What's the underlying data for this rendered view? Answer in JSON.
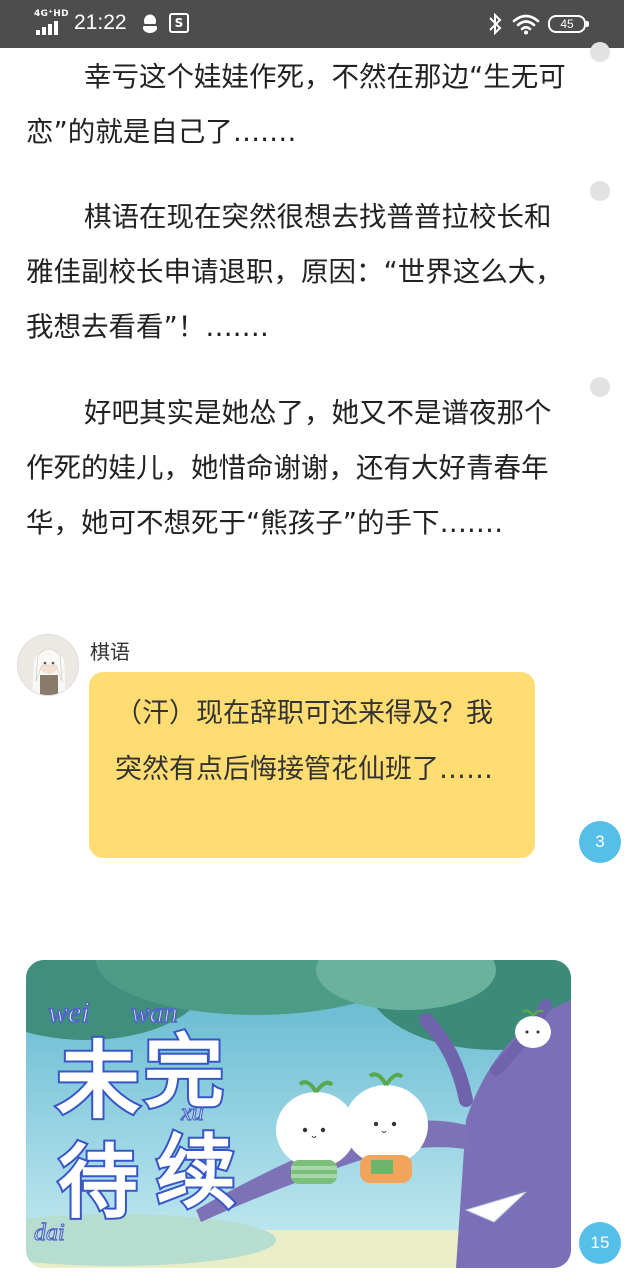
{
  "status_bar": {
    "network": "4G⁺HD",
    "time": "21:22",
    "app_icon_glyph": "S",
    "battery": "45",
    "icons": [
      "signal-icon",
      "qq-icon",
      "app-icon",
      "bluetooth-icon",
      "wifi-icon",
      "battery-icon"
    ]
  },
  "article": {
    "paragraphs": [
      "幸亏这个娃娃作死，不然在那边“生无可恋”的就是自己了….…",
      "棋语在现在突然很想去找普普拉校长和雅佳副校长申请退职，原因：“世界这么大，我想去看看”！….…",
      "好吧其实是她怂了，她又不是谱夜那个作死的娃儿，她惜命谢谢，还有大好青春年华，她可不想死于“熊孩子”的手下….…"
    ]
  },
  "dialogue": {
    "speaker": "棋语",
    "text": "（汗）现在辞职可还来得及？我突然有点后悔接管花仙班了……",
    "comment_count": "3"
  },
  "banner": {
    "title_chars": "未完待续",
    "pinyin": [
      "wei",
      "wan",
      "dai",
      "xu"
    ],
    "comment_count": "15"
  },
  "colors": {
    "status_bar_bg": "#4d4d4d",
    "bubble_bg": "#ffdd72",
    "badge_bg": "#56bfe8",
    "comment_dot": "#e2e2e2"
  }
}
